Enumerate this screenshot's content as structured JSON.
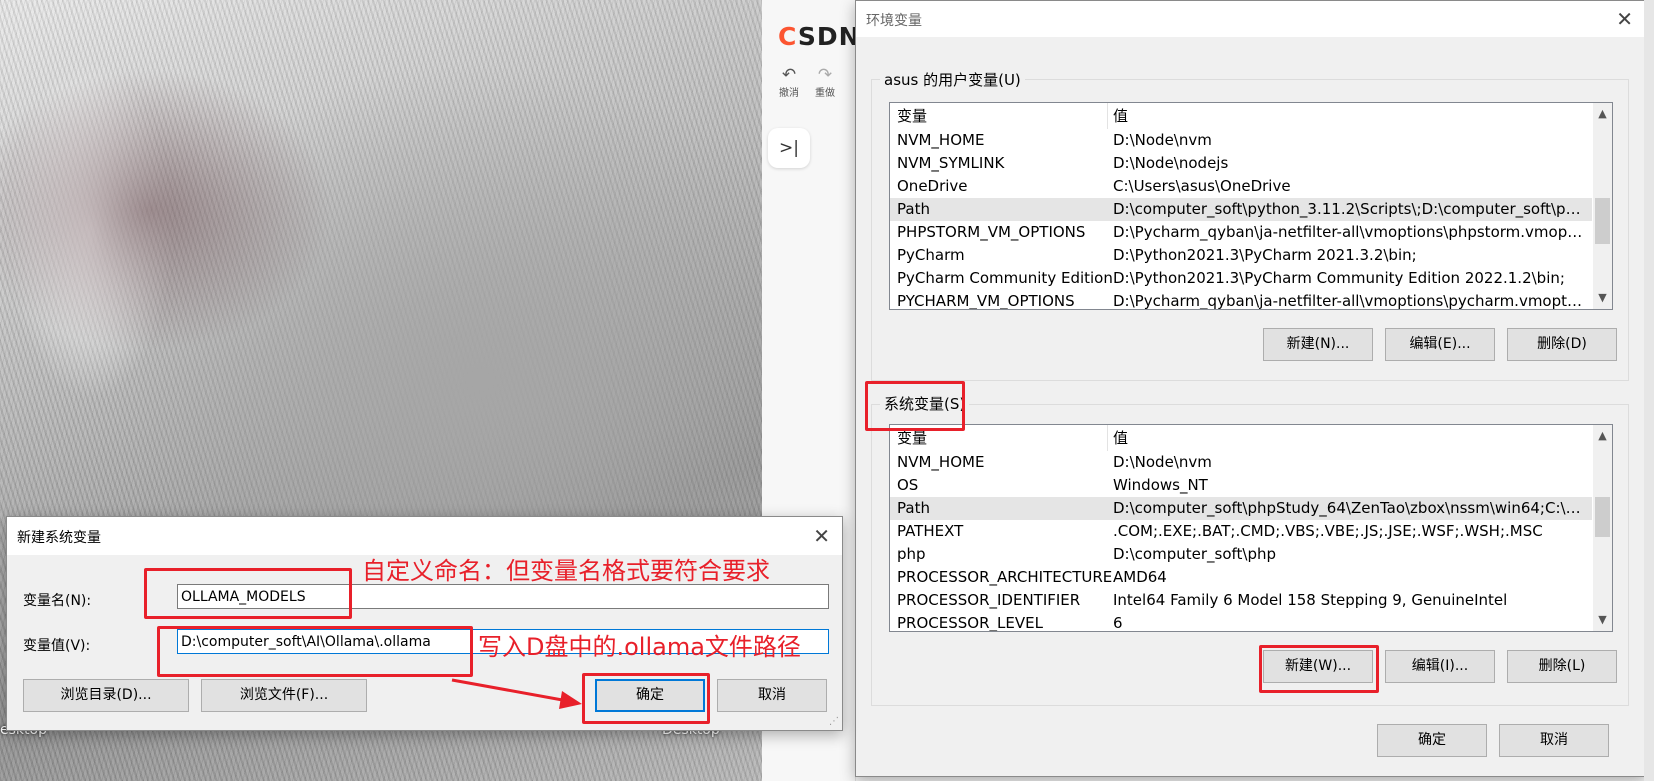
{
  "desktop": {
    "label_left": "esktop",
    "label_right": "Desktop"
  },
  "csdn": {
    "logo_accent": "C",
    "logo_rest": "SDN",
    "undo_label": "撤消",
    "redo_label": "重做",
    "undo_icon": "↶",
    "redo_icon": "↷",
    "collapse_icon": ">|"
  },
  "env_dialog": {
    "title": "环境变量",
    "close_icon": "✕",
    "user_section": {
      "title": "asus 的用户变量(U)",
      "col_var": "变量",
      "col_val": "值",
      "rows": [
        {
          "name": "NVM_HOME",
          "value": "D:\\Node\\nvm"
        },
        {
          "name": "NVM_SYMLINK",
          "value": "D:\\Node\\nodejs"
        },
        {
          "name": "OneDrive",
          "value": "C:\\Users\\asus\\OneDrive"
        },
        {
          "name": "Path",
          "value": "D:\\computer_soft\\python_3.11.2\\Scripts\\;D:\\computer_soft\\pyt..."
        },
        {
          "name": "PHPSTORM_VM_OPTIONS",
          "value": "D:\\Pycharm_qyban\\ja-netfilter-all\\vmoptions\\phpstorm.vmopti..."
        },
        {
          "name": "PyCharm",
          "value": "D:\\Python2021.3\\PyCharm 2021.3.2\\bin;"
        },
        {
          "name": "PyCharm Community Edition",
          "value": "D:\\Python2021.3\\PyCharm Community Edition 2022.1.2\\bin;"
        },
        {
          "name": "PYCHARM_VM_OPTIONS",
          "value": "D:\\Pycharm_qyban\\ja-netfilter-all\\vmoptions\\pycharm.vmoptions"
        }
      ],
      "new_btn": "新建(N)...",
      "edit_btn": "编辑(E)...",
      "delete_btn": "删除(D)"
    },
    "system_section": {
      "title": "系统变量(S)",
      "col_var": "变量",
      "col_val": "值",
      "rows": [
        {
          "name": "NVM_HOME",
          "value": "D:\\Node\\nvm"
        },
        {
          "name": "OS",
          "value": "Windows_NT"
        },
        {
          "name": "Path",
          "value": "D:\\computer_soft\\phpStudy_64\\ZenTao\\zbox\\nssm\\win64;C:\\Pr..."
        },
        {
          "name": "PATHEXT",
          "value": ".COM;.EXE;.BAT;.CMD;.VBS;.VBE;.JS;.JSE;.WSF;.WSH;.MSC"
        },
        {
          "name": "php",
          "value": "D:\\computer_soft\\php"
        },
        {
          "name": "PROCESSOR_ARCHITECTURE",
          "value": "AMD64"
        },
        {
          "name": "PROCESSOR_IDENTIFIER",
          "value": "Intel64 Family 6 Model 158 Stepping 9, GenuineIntel"
        },
        {
          "name": "PROCESSOR_LEVEL",
          "value": "6"
        }
      ],
      "new_btn": "新建(W)...",
      "edit_btn": "编辑(I)...",
      "delete_btn": "删除(L)"
    },
    "ok_btn": "确定",
    "cancel_btn": "取消"
  },
  "new_var_dialog": {
    "title": "新建系统变量",
    "close_icon": "✕",
    "name_label": "变量名(N):",
    "name_value": "OLLAMA_MODELS",
    "value_label": "变量值(V):",
    "value_value": "D:\\computer_soft\\AI\\Ollama\\.ollama",
    "browse_dir_btn": "浏览目录(D)...",
    "browse_file_btn": "浏览文件(F)...",
    "ok_btn": "确定",
    "cancel_btn": "取消"
  },
  "annotations": {
    "name_note": "自定义命名：但变量名格式要符合要求",
    "value_note": "写入D盘中的.ollama文件路径",
    "color": "#e8202a"
  }
}
